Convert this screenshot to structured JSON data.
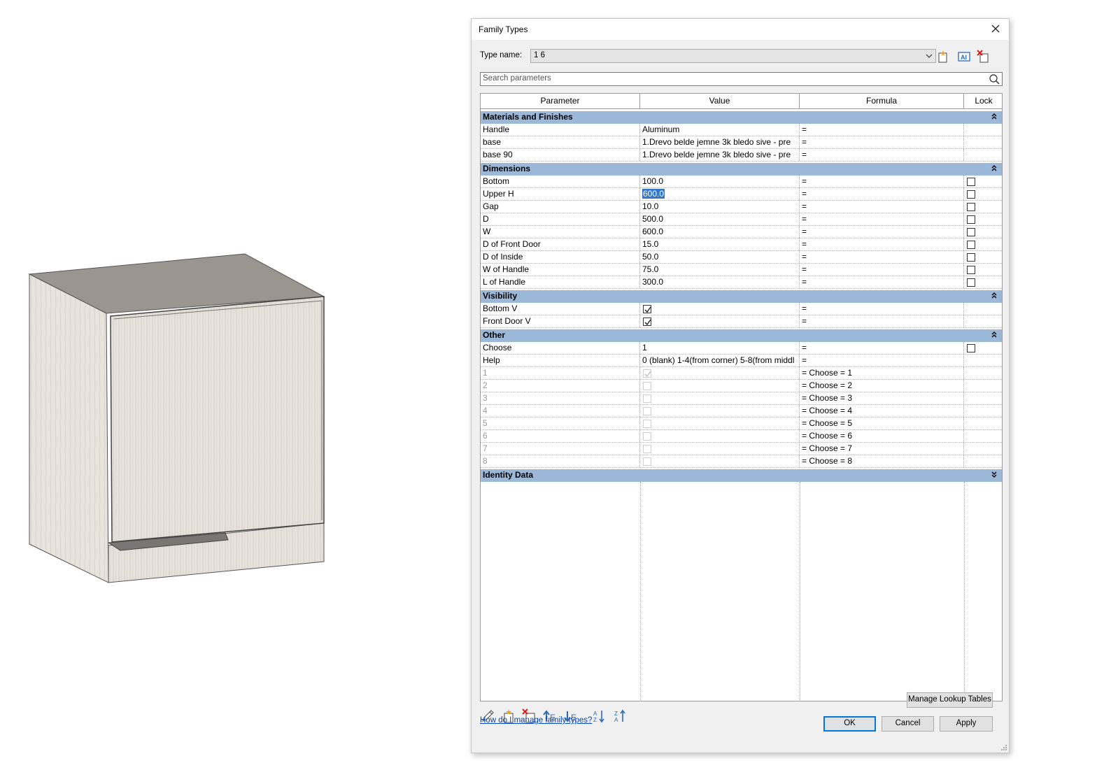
{
  "dialog": {
    "title": "Family Types",
    "type_name_label": "Type name:",
    "type_name_value": "1 6",
    "search_placeholder": "Search parameters",
    "columns": [
      "Parameter",
      "Value",
      "Formula",
      "Lock"
    ],
    "groups": {
      "materials": {
        "label": "Materials and Finishes",
        "rows": [
          {
            "name": "Handle",
            "value": "Aluminum",
            "formula": "="
          },
          {
            "name": "base",
            "value": "1.Drevo belde jemne 3k bledo sive - pre",
            "formula": "="
          },
          {
            "name": "base 90",
            "value": "1.Drevo belde jemne 3k bledo sive - pre",
            "formula": "="
          }
        ]
      },
      "dimensions": {
        "label": "Dimensions",
        "rows": [
          {
            "name": "Bottom",
            "value": "100.0",
            "formula": "="
          },
          {
            "name": "Upper H",
            "value": "600.0",
            "formula": "="
          },
          {
            "name": "Gap",
            "value": "10.0",
            "formula": "="
          },
          {
            "name": "D",
            "value": "500.0",
            "formula": "="
          },
          {
            "name": "W",
            "value": "600.0",
            "formula": "="
          },
          {
            "name": "D of Front Door",
            "value": "15.0",
            "formula": "="
          },
          {
            "name": "D of Inside",
            "value": "50.0",
            "formula": "="
          },
          {
            "name": "W of Handle",
            "value": "75.0",
            "formula": "="
          },
          {
            "name": "L of Handle",
            "value": "300.0",
            "formula": "="
          }
        ]
      },
      "visibility": {
        "label": "Visibility",
        "rows": [
          {
            "name": "Bottom V",
            "checked": true,
            "formula": "="
          },
          {
            "name": "Front Door V",
            "checked": true,
            "formula": "="
          }
        ]
      },
      "other": {
        "label": "Other",
        "rows": [
          {
            "name": "Choose",
            "value": "1",
            "formula": "="
          },
          {
            "name": "Help",
            "value": "0 (blank) 1-4(from corner) 5-8(from middl",
            "formula": "="
          },
          {
            "name": "1",
            "checked": true,
            "formula": "= Choose = 1"
          },
          {
            "name": "2",
            "checked": false,
            "formula": "= Choose = 2"
          },
          {
            "name": "3",
            "checked": false,
            "formula": "= Choose = 3"
          },
          {
            "name": "4",
            "checked": false,
            "formula": "= Choose = 4"
          },
          {
            "name": "5",
            "checked": false,
            "formula": "= Choose = 5"
          },
          {
            "name": "6",
            "checked": false,
            "formula": "= Choose = 6"
          },
          {
            "name": "7",
            "checked": false,
            "formula": "= Choose = 7"
          },
          {
            "name": "8",
            "checked": false,
            "formula": "= Choose = 8"
          }
        ]
      },
      "identity": {
        "label": "Identity Data"
      }
    },
    "buttons": {
      "manage_lookup": "Manage Lookup Tables",
      "ok": "OK",
      "cancel": "Cancel",
      "apply": "Apply"
    },
    "help_link": "How do I manage family types?",
    "colors": {
      "group_header": "#9cb8d8",
      "selection": "#3476c8",
      "link": "#0645ad"
    }
  }
}
